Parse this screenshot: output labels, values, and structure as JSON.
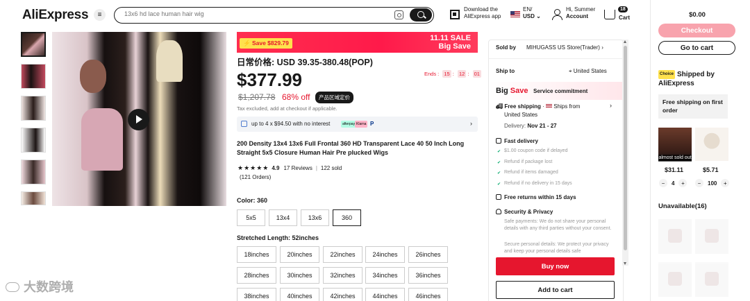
{
  "header": {
    "logo": "AliExpress",
    "search_placeholder": "13x6 hd lace human hair wig",
    "download_line1": "Download the",
    "download_line2": "AliExpress app",
    "lang_line1": "EN/",
    "lang_line2": "USD",
    "account_line1": "Hi, Summer",
    "account_line2": "Account",
    "cart_count": "18",
    "cart_label": "Cart"
  },
  "banner": {
    "save_label": "Save $829.79",
    "sale_line1": "11.11 SALE",
    "sale_line2": "Big Save"
  },
  "price": {
    "daily": "日常价格: USD 39.35-380.48(POP)",
    "current": "$377.99",
    "ends_label": "Ends :",
    "countdown": [
      "15",
      "12",
      "01"
    ],
    "original": "$1,207.78",
    "discount": "68% off",
    "region_tag": "产品区域定价",
    "tax_note": "Tax excluded, add at checkout if applicable.",
    "installment": "up to 4 x $94.50 with no interest",
    "pay_badges": [
      "afterpay",
      "Klarna",
      "P"
    ]
  },
  "product": {
    "title": "200 Density 13x4 13x6 Full Frontal 360 HD Transparent Lace 40 50 Inch Long Straight 5x5 Closure Human Hair Pre plucked Wigs",
    "stars": "★★★★★",
    "rating": "4.9",
    "reviews": "17 Reviews",
    "sold": "122 sold",
    "orders": "(121 Orders)"
  },
  "color": {
    "label": "Color: 360",
    "options": [
      "5x5",
      "13x4",
      "13x6",
      "360"
    ],
    "selected": "360"
  },
  "length": {
    "label": "Stretched Length: 52inches",
    "options": [
      "18inches",
      "20inches",
      "22inches",
      "24inches",
      "26inches",
      "28inches",
      "30inches",
      "32inches",
      "34inches",
      "36inches",
      "38inches",
      "40inches",
      "42inches",
      "44inches",
      "46inches"
    ]
  },
  "detail": {
    "sold_by_label": "Sold by",
    "store": "MIHUGASS US Store(Trader)",
    "ship_to_label": "Ship to",
    "ship_to": "United States",
    "big": "Big",
    "save": "Save",
    "service": "Service commitment",
    "free_shipping": "Free shipping",
    "ships_from": "Ships from",
    "ships_from_country": "United States",
    "delivery_label": "Delivery:",
    "delivery_dates": "Nov 21 - 27",
    "fast_delivery": "Fast delivery",
    "fast_items": [
      "$1.00 coupon code if delayed",
      "Refund if package lost",
      "Refund if items damaged",
      "Refund if no delivery in 15 days"
    ],
    "free_returns": "Free returns within 15 days",
    "security": "Security & Privacy",
    "security_text1": "Safe payments: We do not share your personal details with any third parties without your consent.",
    "security_text2": "Secure personal details: We protect your privacy and keep your personal details safe",
    "buy_now": "Buy now",
    "add_to_cart": "Add to cart"
  },
  "sidebar": {
    "total": "$0.00",
    "checkout": "Checkout",
    "go_to_cart": "Go to cart",
    "choice_tag": "Choice",
    "choice_title": "Shipped by AliExpress",
    "free_ship": "Free shipping on first order",
    "sold_out": "almost sold out",
    "items": [
      {
        "price": "$31.11",
        "qty": "4"
      },
      {
        "price": "$5.71",
        "qty": "100"
      }
    ],
    "unavailable": "Unavailable(16)"
  },
  "watermark": "大数跨境",
  "colors": {
    "accent": "#e6162e",
    "checkout_disabled": "#f8a3ad",
    "choice_yellow": "#ffe14d"
  }
}
